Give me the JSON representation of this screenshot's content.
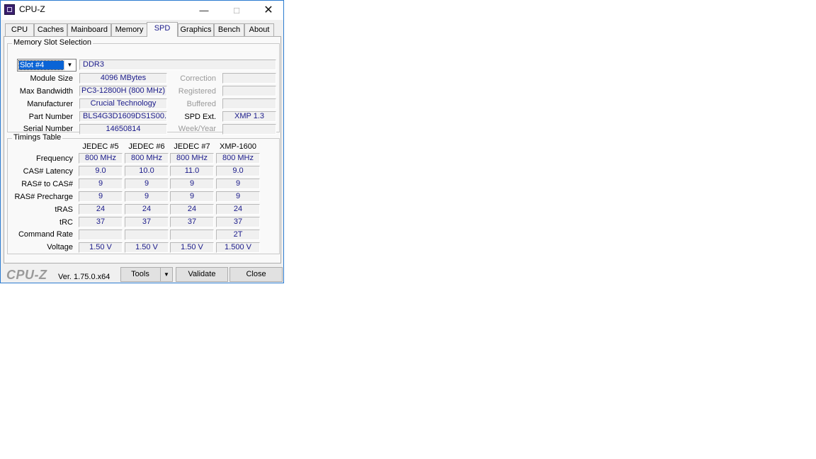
{
  "window": {
    "title": "CPU-Z"
  },
  "tabs": [
    "CPU",
    "Caches",
    "Mainboard",
    "Memory",
    "SPD",
    "Graphics",
    "Bench",
    "About"
  ],
  "active_tab": "SPD",
  "slot_group": {
    "title": "Memory Slot Selection",
    "slot_selected": "Slot #4",
    "memory_type": "DDR3",
    "labels": {
      "module_size": "Module Size",
      "max_bandwidth": "Max Bandwidth",
      "manufacturer": "Manufacturer",
      "part_number": "Part Number",
      "serial_number": "Serial Number",
      "correction": "Correction",
      "registered": "Registered",
      "buffered": "Buffered",
      "spd_ext": "SPD Ext.",
      "week_year": "Week/Year"
    },
    "values": {
      "module_size": "4096 MBytes",
      "max_bandwidth": "PC3-12800H (800 MHz)",
      "manufacturer": "Crucial Technology",
      "part_number": "BLS4G3D1609DS1S00.",
      "serial_number": "14650814",
      "spd_ext": "XMP 1.3"
    }
  },
  "timings": {
    "title": "Timings Table",
    "columns": [
      "JEDEC #5",
      "JEDEC #6",
      "JEDEC #7",
      "XMP-1600"
    ],
    "rows": [
      {
        "label": "Frequency",
        "values": [
          "800 MHz",
          "800 MHz",
          "800 MHz",
          "800 MHz"
        ]
      },
      {
        "label": "CAS# Latency",
        "values": [
          "9.0",
          "10.0",
          "11.0",
          "9.0"
        ]
      },
      {
        "label": "RAS# to CAS#",
        "values": [
          "9",
          "9",
          "9",
          "9"
        ]
      },
      {
        "label": "RAS# Precharge",
        "values": [
          "9",
          "9",
          "9",
          "9"
        ]
      },
      {
        "label": "tRAS",
        "values": [
          "24",
          "24",
          "24",
          "24"
        ]
      },
      {
        "label": "tRC",
        "values": [
          "37",
          "37",
          "37",
          "37"
        ]
      },
      {
        "label": "Command Rate",
        "values": [
          "",
          "",
          "",
          "2T"
        ]
      },
      {
        "label": "Voltage",
        "values": [
          "1.50 V",
          "1.50 V",
          "1.50 V",
          "1.500 V"
        ]
      }
    ]
  },
  "footer": {
    "brand": "CPU-Z",
    "version": "Ver. 1.75.0.x64",
    "tools_label": "Tools",
    "validate_label": "Validate",
    "close_label": "Close"
  }
}
